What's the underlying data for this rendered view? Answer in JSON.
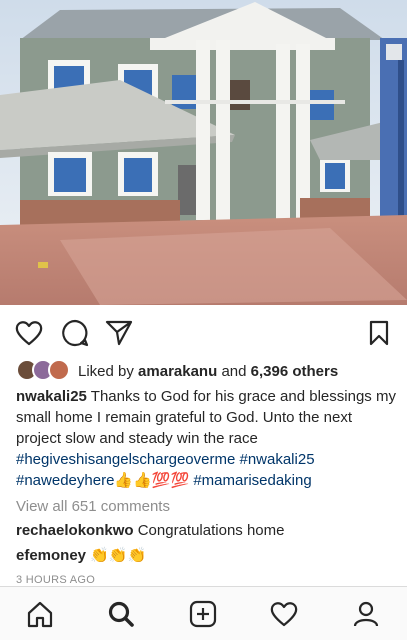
{
  "post": {
    "image_alt_icon": "house-photo",
    "likes": {
      "prefix": "Liked by",
      "user": "amarakanu",
      "connector": "and",
      "count": "6,396 others"
    },
    "caption": {
      "username": "nwakali25",
      "text": "Thanks to God for his grace and blessings my small home I remain grateful to God. Unto the next project slow and steady win the race",
      "tag1": "#hegiveshisangelschargeoverme",
      "tag2": "#nwakali25",
      "tag3": "#nawedeyhere",
      "emoji_mid": "👍👍💯💯",
      "tag4": "#mamarisedaking"
    },
    "view_all_comments": "View all 651 comments",
    "comments": [
      {
        "username": "rechaelokonkwo",
        "text": "Congratulations home"
      },
      {
        "username": "efemoney",
        "text": "👏👏👏"
      }
    ],
    "timestamp": "3 HOURS AGO"
  },
  "actions": {
    "like_icon": "heart-icon",
    "comment_icon": "comment-icon",
    "share_icon": "share-icon",
    "save_icon": "bookmark-icon"
  },
  "bottom_nav": [
    "home-icon",
    "search-icon",
    "add-post-icon",
    "activity-heart-icon",
    "profile-icon"
  ],
  "colors": {
    "hashtag": "#003569",
    "muted": "#8e8e8e",
    "text": "#262626"
  }
}
